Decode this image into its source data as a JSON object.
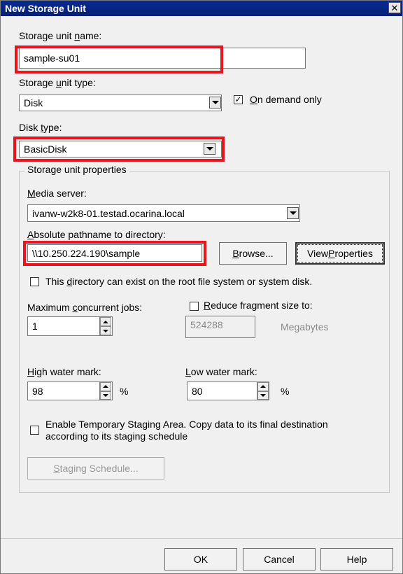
{
  "window": {
    "title": "New Storage Unit",
    "close_glyph": "✕"
  },
  "storage_unit_name": {
    "label_pre": "Storage unit ",
    "label_u": "n",
    "label_post": "ame:",
    "value": "sample-su01"
  },
  "storage_unit_type": {
    "label_pre": "Storage ",
    "label_u": "u",
    "label_post": "nit type:",
    "value": "Disk"
  },
  "on_demand_only": {
    "label_pre": "",
    "label_u": "O",
    "label_post": "n demand only",
    "checked": true,
    "check_glyph": "✓"
  },
  "disk_type": {
    "label_pre": "Disk ",
    "label_u": "t",
    "label_post": "ype:",
    "value": "BasicDisk"
  },
  "properties_group": {
    "title": "Storage unit properties"
  },
  "media_server": {
    "label_pre": "",
    "label_u": "M",
    "label_post": "edia server:",
    "value": "ivanw-w2k8-01.testad.ocarina.local"
  },
  "pathname": {
    "label_pre": "",
    "label_u": "A",
    "label_post": "bsolute pathname to directory:",
    "value": "\\\\10.250.224.190\\sample"
  },
  "browse_button": {
    "label_pre": "",
    "label_u": "B",
    "label_post": "rowse..."
  },
  "view_properties_button": {
    "label_pre": "View ",
    "label_u": "P",
    "label_post": "roperties"
  },
  "root_fs": {
    "label_pre": "This ",
    "label_u": "d",
    "label_post": "irectory can exist on the root file system or system disk.",
    "checked": false
  },
  "max_jobs": {
    "label_pre": "Maximum ",
    "label_u": "c",
    "label_post": "oncurrent jobs:",
    "value": "1"
  },
  "reduce_fragment": {
    "label_pre": "",
    "label_u": "R",
    "label_post": "educe fragment size to:",
    "checked": false,
    "value": "524288",
    "unit": "Megabytes"
  },
  "high_water": {
    "label_pre": "",
    "label_u": "H",
    "label_post": "igh water mark:",
    "value": "98",
    "unit": "%"
  },
  "low_water": {
    "label_pre": "",
    "label_u": "L",
    "label_post": "ow water mark:",
    "value": "80",
    "unit": "%"
  },
  "staging": {
    "line1": "Enable Temporary Staging Area. Copy data to its final destination",
    "line2": "according to its staging schedule",
    "checked": false
  },
  "staging_schedule_button": {
    "label_pre": "",
    "label_u": "S",
    "label_post": "taging Schedule..."
  },
  "footer": {
    "ok": "OK",
    "cancel": "Cancel",
    "help": "Help"
  },
  "colors": {
    "highlight": "#e8141f",
    "titlebar": "#0a2a8c"
  }
}
